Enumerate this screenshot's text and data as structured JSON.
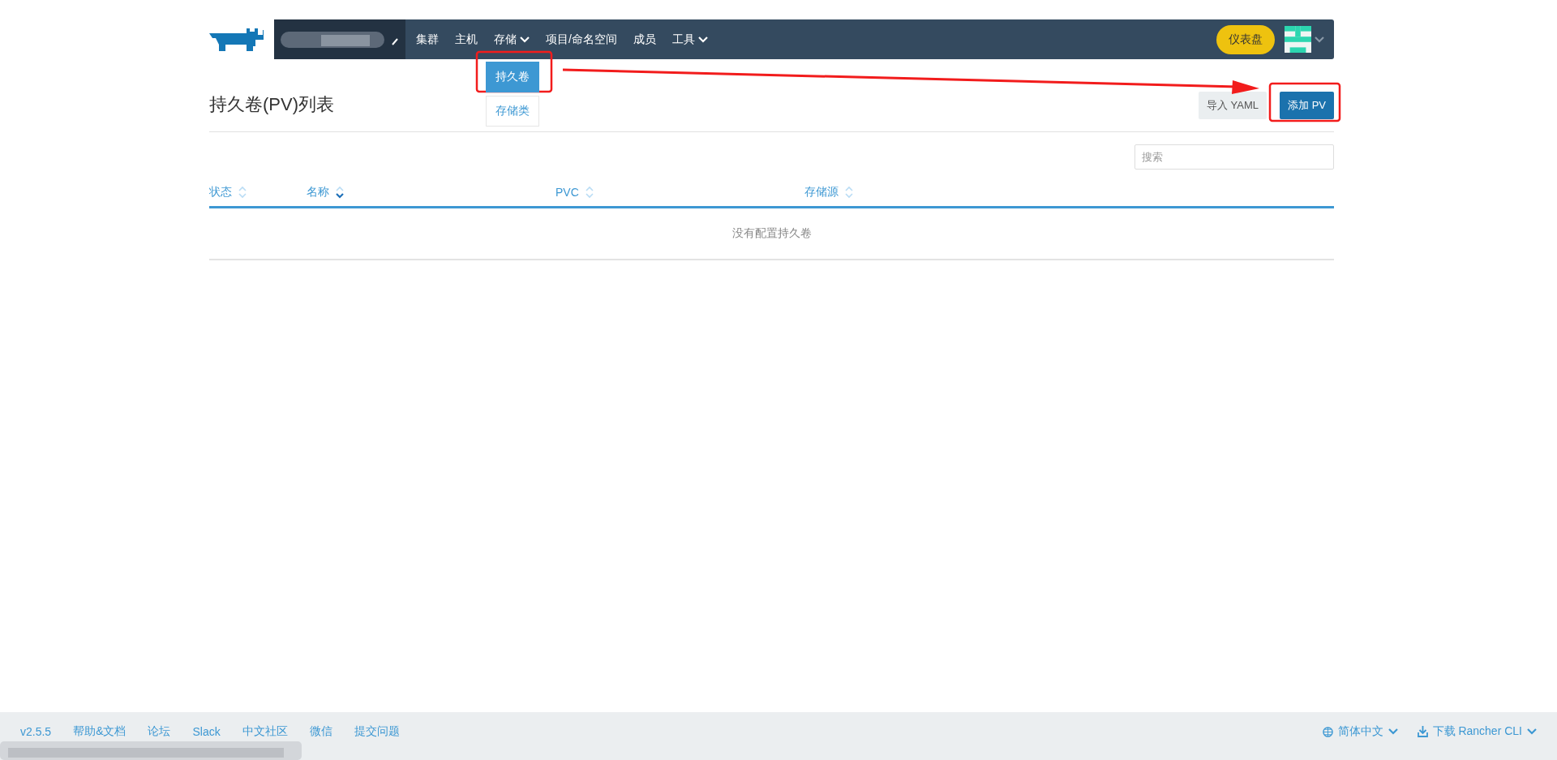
{
  "header": {
    "nav": [
      {
        "label": "集群",
        "dropdown": false
      },
      {
        "label": "主机",
        "dropdown": false
      },
      {
        "label": "存储",
        "dropdown": true,
        "expanded": true,
        "menu": [
          {
            "label": "持久卷",
            "selected": true
          },
          {
            "label": "存储类",
            "selected": false
          }
        ]
      },
      {
        "label": "项目/命名空间",
        "dropdown": false
      },
      {
        "label": "成员",
        "dropdown": false
      },
      {
        "label": "工具",
        "dropdown": true
      }
    ],
    "dashboard_button": "仪表盘"
  },
  "page": {
    "title": "持久卷(PV)列表",
    "buttons": [
      {
        "label": "导入 YAML",
        "kind": "secondary"
      },
      {
        "label": "添加 PV",
        "kind": "primary"
      }
    ],
    "search": {
      "placeholder": "搜索"
    },
    "table": {
      "columns": [
        {
          "label": "状态",
          "sorted": false
        },
        {
          "label": "名称",
          "sorted": true
        },
        {
          "label": "PVC",
          "sorted": false
        },
        {
          "label": "存储源",
          "sorted": false
        }
      ],
      "empty_message": "没有配置持久卷"
    }
  },
  "footer": {
    "links": [
      "v2.5.5",
      "帮助&文档",
      "论坛",
      "Slack",
      "中文社区",
      "微信",
      "提交问题"
    ],
    "language": "简体中文",
    "download": "下载 Rancher CLI"
  }
}
